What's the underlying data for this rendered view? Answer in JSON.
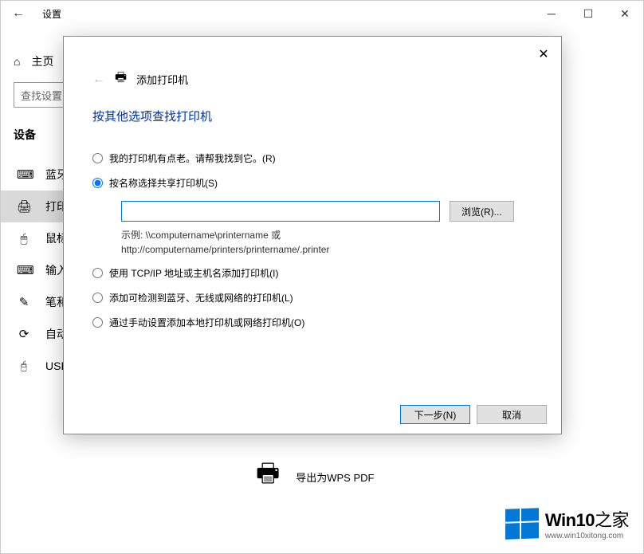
{
  "settings": {
    "title": "设置",
    "home": "主页",
    "search_placeholder": "查找设置",
    "section": "设备",
    "nav": [
      {
        "icon": "⌨",
        "label": "蓝牙"
      },
      {
        "icon": "🖨",
        "label": "打印"
      },
      {
        "icon": "🖱",
        "label": "鼠标"
      },
      {
        "icon": "⌨",
        "label": "输入"
      },
      {
        "icon": "✎",
        "label": "笔和"
      },
      {
        "icon": "⟳",
        "label": "自动"
      },
      {
        "icon": "🖯",
        "label": "USB"
      }
    ],
    "printer_list_item": "导出为WPS PDF"
  },
  "dialog": {
    "header": "添加打印机",
    "title": "按其他选项查找打印机",
    "radios": {
      "r1": "我的打印机有点老。请帮我找到它。(R)",
      "r2": "按名称选择共享打印机(S)",
      "r3": "使用 TCP/IP 地址或主机名添加打印机(I)",
      "r4": "添加可检测到蓝牙、无线或网络的打印机(L)",
      "r5": "通过手动设置添加本地打印机或网络打印机(O)"
    },
    "browse": "浏览(R)...",
    "example_l1": "示例: \\\\computername\\printername 或",
    "example_l2": "http://computername/printers/printername/.printer",
    "next": "下一步(N)",
    "cancel": "取消"
  },
  "watermark": {
    "brand_a": "Win10",
    "brand_b": "之家",
    "url": "www.win10xitong.com"
  }
}
